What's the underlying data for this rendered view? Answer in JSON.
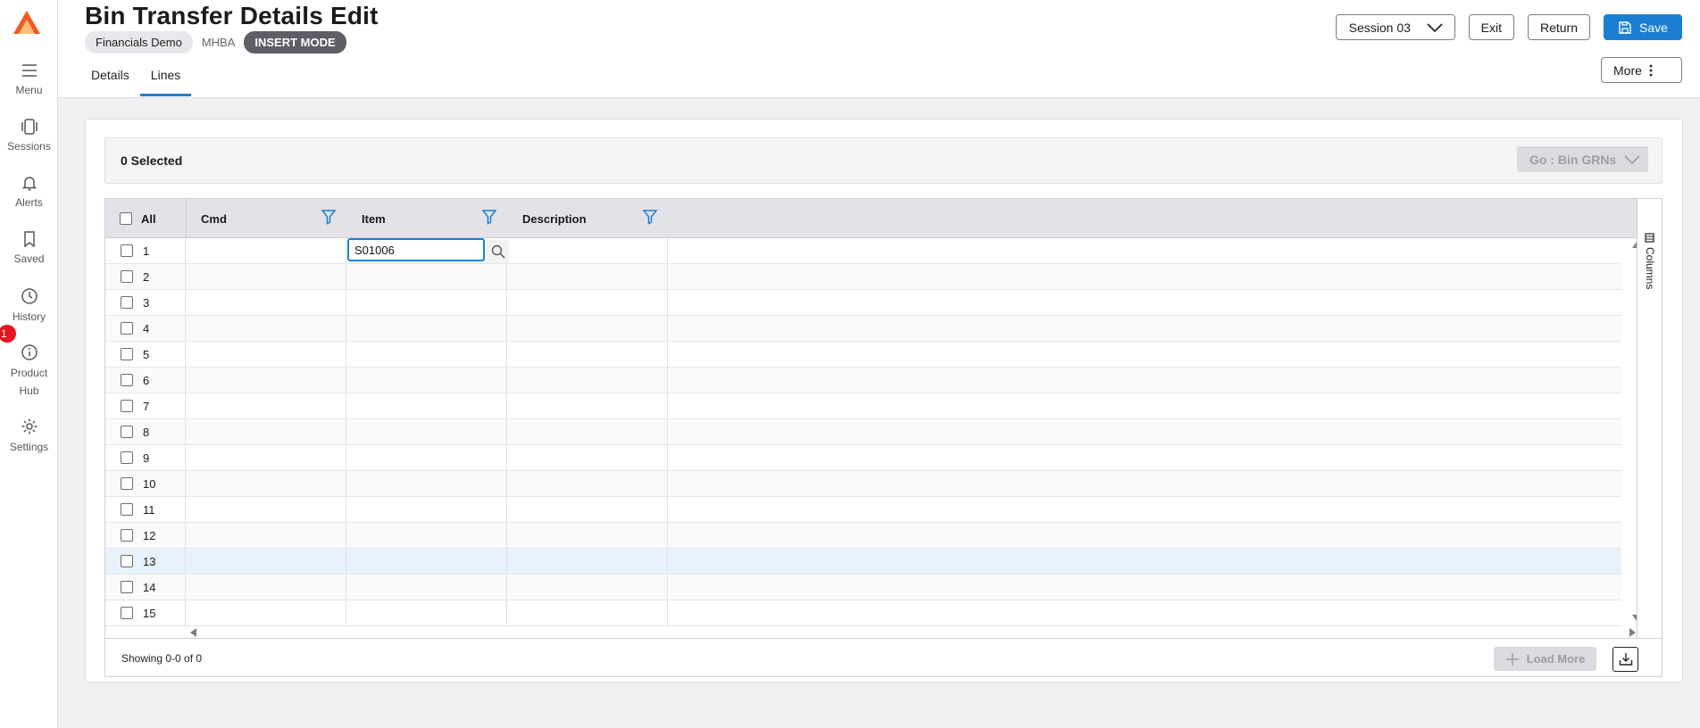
{
  "app": {
    "title": "Bin Transfer Details Edit"
  },
  "header": {
    "company": "Financials Demo",
    "code": "MHBA",
    "mode": "INSERT MODE",
    "session_label": "Session 03",
    "exit_label": "Exit",
    "return_label": "Return",
    "save_label": "Save",
    "more_label": "More",
    "tabs": [
      {
        "label": "Details"
      },
      {
        "label": "Lines"
      }
    ]
  },
  "sidebar": {
    "items": [
      {
        "label": "Menu",
        "icon": "menu-icon"
      },
      {
        "label": "Sessions",
        "icon": "sessions-icon"
      },
      {
        "label": "Alerts",
        "icon": "bell-icon"
      },
      {
        "label": "Saved",
        "icon": "bookmark-icon"
      },
      {
        "label": "History",
        "icon": "clock-icon"
      },
      {
        "label": "Product",
        "label2": "Hub",
        "icon": "info-icon"
      },
      {
        "label": "Settings",
        "icon": "gear-icon"
      }
    ],
    "badge": "1"
  },
  "selection": {
    "count_label": "0 Selected",
    "go_label": "Go : Bin GRNs"
  },
  "grid": {
    "columns": {
      "all": "All",
      "cmd": "Cmd",
      "item": "Item",
      "description": "Description"
    },
    "columns_panel_label": "Columns",
    "item_input_value": "S01006",
    "rows": [
      "1",
      "2",
      "3",
      "4",
      "5",
      "6",
      "7",
      "8",
      "9",
      "10",
      "11",
      "12",
      "13",
      "14",
      "15"
    ],
    "highlighted_row": "13"
  },
  "footer": {
    "showing": "Showing 0-0 of 0",
    "load_more": "Load More"
  },
  "colors": {
    "accent": "#1a7fd3",
    "logo": "#f15a24",
    "badge": "#e6141e"
  }
}
